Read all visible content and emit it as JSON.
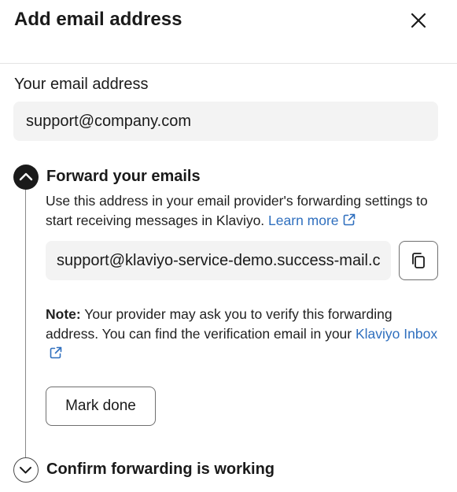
{
  "dialog": {
    "title": "Add email address"
  },
  "email": {
    "label": "Your email address",
    "value": "support@company.com"
  },
  "forward_step": {
    "title": "Forward your emails",
    "description": "Use this address in your email provider's forwarding settings to start receiving messages in Klaviyo.",
    "learn_more": "Learn more",
    "forwarding_address": "support@klaviyo-service-demo.success-mail.com",
    "note_label": "Note:",
    "note_text": "Your provider may ask you to verify this forwarding address. You can find the verification email in your",
    "inbox_link": "Klaviyo Inbox",
    "mark_done": "Mark done"
  },
  "confirm_step": {
    "title": "Confirm forwarding is working"
  },
  "colors": {
    "link": "#2f6fbe",
    "field_bg": "#f3f3f3",
    "text": "#1a1a1a"
  },
  "icons": {
    "close": "close-icon",
    "collapse": "chevron-up-icon",
    "expand": "chevron-down-icon",
    "copy": "copy-icon",
    "external": "external-link-icon"
  }
}
